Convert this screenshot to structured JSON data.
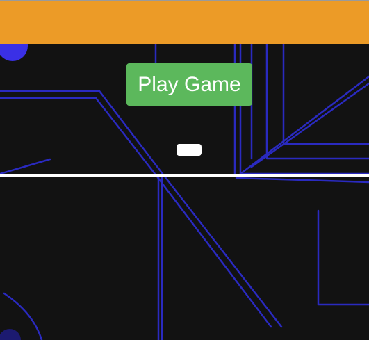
{
  "header": {
    "bar_color": "#ec9b27"
  },
  "board": {
    "background_color": "#121212",
    "line_color": "#2a2ac0",
    "orb_color": "#3a30e6"
  },
  "controls": {
    "play_label": "Play Game",
    "play_color": "#5cb85c"
  },
  "player": {
    "paddle_color": "#ffffff"
  }
}
